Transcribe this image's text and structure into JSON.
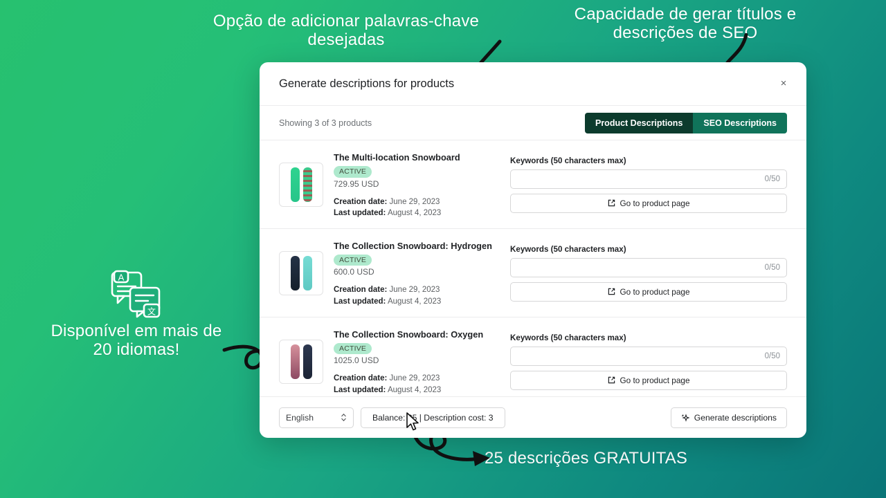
{
  "theme": {
    "bg_gradient_start": "#27c16f",
    "bg_gradient_end": "#0a7578",
    "tab_inactive": "#0c3b2d",
    "tab_active": "#10735a",
    "badge_bg": "#aee9cd"
  },
  "promos": {
    "keywords": "Opção de adicionar palavras-chave desejadas",
    "seo": "Capacidade de gerar títulos e descrições de SEO",
    "languages": "Disponível em mais de 20 idiomas!",
    "free": "25 descrições GRATUITAS"
  },
  "modal": {
    "title": "Generate descriptions for products",
    "close_label": "×",
    "showing_text": "Showing 3 of 3 products",
    "tabs": [
      {
        "label": "Product Descriptions",
        "active": false
      },
      {
        "label": "SEO Descriptions",
        "active": true
      }
    ],
    "keywords_label": "Keywords (50 characters max)",
    "keywords_value": "",
    "keywords_placeholder": "",
    "keywords_counter": "0/50",
    "product_page_label": "Go to product page",
    "creation_date_label": "Creation date:",
    "last_updated_label": "Last updated:",
    "products": [
      {
        "name": "The Multi-location Snowboard",
        "status": "ACTIVE",
        "price": "729.95 USD",
        "creation_date": "June 29, 2023",
        "last_updated": "August 4, 2023",
        "thumb_colors": [
          "#2ecf8d",
          "#3bbf86"
        ]
      },
      {
        "name": "The Collection Snowboard: Hydrogen",
        "status": "ACTIVE",
        "price": "600.0 USD",
        "creation_date": "June 29, 2023",
        "last_updated": "August 4, 2023",
        "thumb_colors": [
          "#1d2b3a",
          "#63d3cc"
        ]
      },
      {
        "name": "The Collection Snowboard: Oxygen",
        "status": "ACTIVE",
        "price": "1025.0 USD",
        "creation_date": "June 29, 2023",
        "last_updated": "August 4, 2023",
        "thumb_colors": [
          "#b0657c",
          "#29324c"
        ]
      }
    ],
    "footer": {
      "language": "English",
      "balance": "Balance: 25 | Description cost: 3",
      "generate_label": "Generate descriptions"
    }
  }
}
